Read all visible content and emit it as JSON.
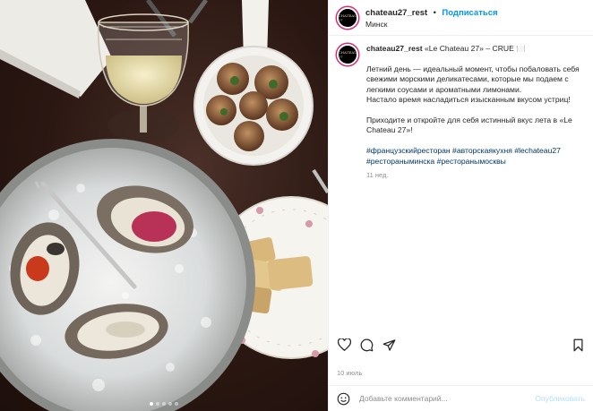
{
  "carousel": {
    "count": 5,
    "active_index": 0
  },
  "header": {
    "username": "chateau27_rest",
    "separator": "•",
    "follow_label": "Подписаться",
    "location": "Минск",
    "avatar_text": "CHATEAU 27"
  },
  "caption": {
    "username": "chateau27_rest",
    "title": "«Le Chateau 27» – CRUE 🍽️",
    "lines": [
      "Летний день — идеальный момент, чтобы побаловать себя",
      "свежими морскими деликатесами, которые мы подаем с",
      "легкими соусами и ароматными лимонами.",
      "Настало время насладиться изысканным вкусом устриц!"
    ],
    "lines2": [
      "Приходите и откройте для себя истинный вкус лета в «Le",
      "Chateau 27»!"
    ],
    "hashtags_line1": [
      "#французскийресторан",
      "#авторскаякухня",
      "#lechateau27"
    ],
    "hashtags_line2": [
      "#рестораныминска",
      "#ресторанымосквы"
    ],
    "time_ago": "11 нед."
  },
  "actions": {
    "like_icon": "heart-icon",
    "comment_icon": "comment-icon",
    "share_icon": "send-icon",
    "save_icon": "bookmark-icon"
  },
  "date": "10 июль",
  "comment_box": {
    "emoji_icon": "smiley-icon",
    "placeholder": "Добавьте комментарий...",
    "post_label": "Опубликовать"
  },
  "colors": {
    "link": "#0095f6",
    "hashtag": "#00376b",
    "muted": "#8e8e8e",
    "post_disabled": "#b2dffc"
  }
}
